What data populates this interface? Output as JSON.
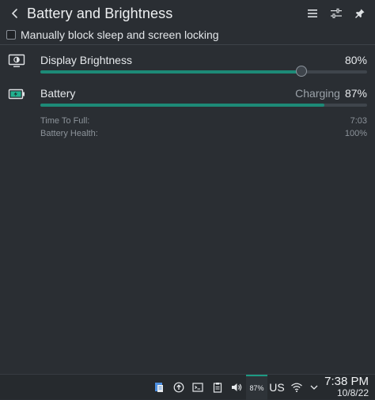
{
  "header": {
    "title": "Battery and Brightness"
  },
  "sleep_block": {
    "label": "Manually block sleep and screen locking",
    "checked": false
  },
  "brightness": {
    "label": "Display Brightness",
    "value_text": "80%",
    "value_fraction": 0.8
  },
  "battery": {
    "label": "Battery",
    "status": "Charging",
    "value_text": "87%",
    "value_fraction": 0.87,
    "details": [
      {
        "label": "Time To Full:",
        "value": "7:03"
      },
      {
        "label": "Battery Health:",
        "value": "100%"
      }
    ]
  },
  "taskbar": {
    "battery_percent": "87%",
    "keyboard_layout": "US",
    "time": "7:38 PM",
    "date": "10/8/22"
  },
  "colors": {
    "accent": "#1d8a77",
    "background": "#2a2e33"
  }
}
